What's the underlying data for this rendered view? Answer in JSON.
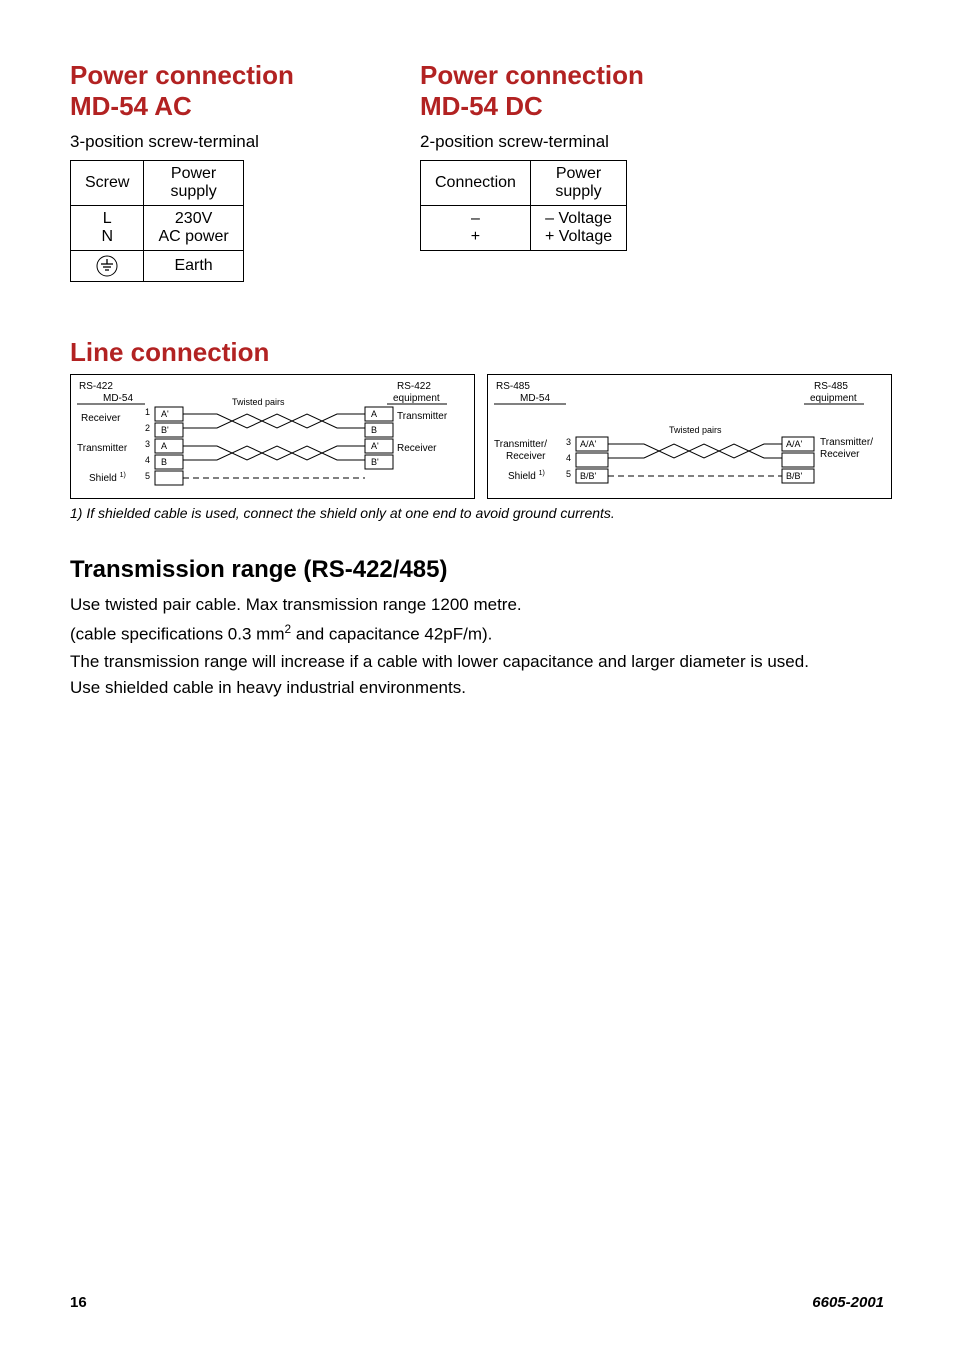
{
  "left_block": {
    "heading_line1": "Power connection",
    "heading_line2": "MD-54 AC",
    "subhead": "3-position screw-terminal",
    "table": {
      "col1_header": "Screw",
      "col2_header": "Power supply",
      "row1_col1_line1": "L",
      "row1_col1_line2": "N",
      "row1_col2_line1": "230V",
      "row1_col2_line2": "AC power",
      "row2_col2": "Earth"
    }
  },
  "right_block": {
    "heading_line1": "Power connection",
    "heading_line2": "MD-54 DC",
    "subhead": "2-position screw-terminal",
    "table": {
      "col1_header": "Connection",
      "col2_header": "Power supply",
      "row1_col1_line1": "–",
      "row1_col1_line2": "+",
      "row1_col2_line1": "– Voltage",
      "row1_col2_line2": "+ Voltage"
    }
  },
  "line_section": {
    "heading": "Line connection",
    "left_diagram": {
      "top_left_line1": "RS-422",
      "top_left_line2": "MD-54",
      "top_mid": "Twisted pairs",
      "top_right_line1": "RS-422",
      "top_right_line2": "equipment",
      "receiver_label": "Receiver",
      "transmitter_label": "Transmitter",
      "shield_label": "Shield",
      "shield_sup": "1)",
      "right_transmitter": "Transmitter",
      "right_receiver": "Receiver",
      "pins": [
        "1",
        "2",
        "3",
        "4",
        "5"
      ],
      "sig_left": [
        "A'",
        "B'",
        "A",
        "B"
      ],
      "sig_right": [
        "A",
        "B",
        "A'",
        "B'"
      ]
    },
    "right_diagram": {
      "top_left_line1": "RS-485",
      "top_left_line2": "MD-54",
      "top_mid": "Twisted pairs",
      "top_right_line1": "RS-485",
      "top_right_line2": "equipment",
      "txrx_label_line1": "Transmitter/",
      "txrx_label_line2": "Receiver",
      "shield_label": "Shield",
      "shield_sup": "1)",
      "right_line1": "Transmitter/",
      "right_line2": "Receiver",
      "pins": [
        "3",
        "4",
        "5"
      ],
      "sig_left": [
        "A/A'",
        "B/B'"
      ],
      "sig_right": [
        "A/A'",
        "B/B'"
      ]
    },
    "footnote": "1) If shielded cable is used, connect the shield only at one end to avoid ground currents."
  },
  "trans_section": {
    "heading": "Transmission range (RS-422/485)",
    "p1": "Use twisted pair cable. Max transmission range 1200 metre.",
    "p2a": "(cable specifications 0.3 mm",
    "p2b": " and capacitance 42pF/m).",
    "p3": "The transmission range will increase if a cable with lower capacitance and larger diameter is used.",
    "p4": "Use shielded cable in heavy industrial environments."
  },
  "footer": {
    "page": "16",
    "doc": "6605-2001"
  }
}
